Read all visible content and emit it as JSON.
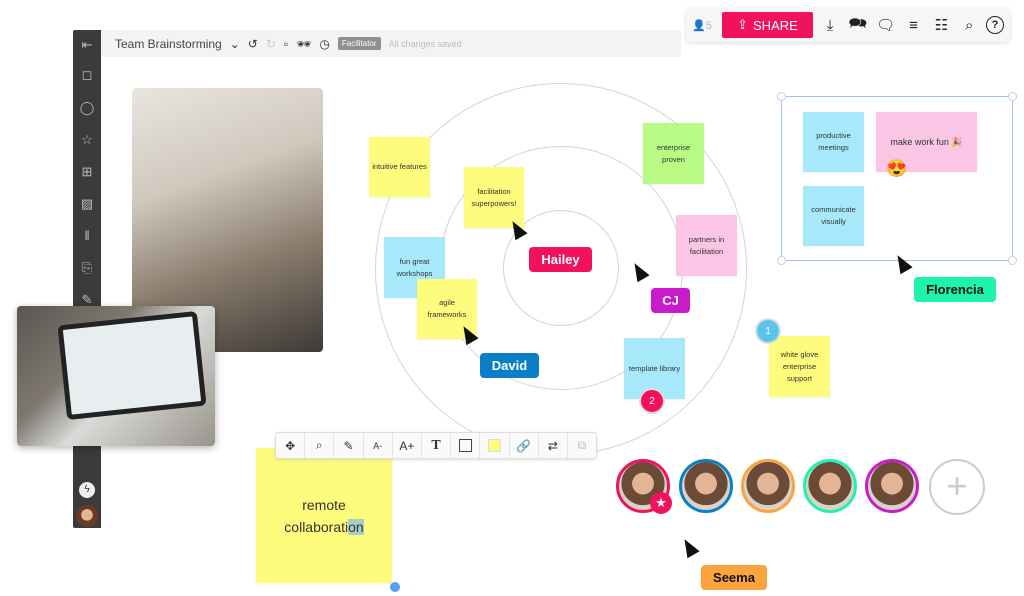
{
  "topbar": {
    "board_title": "Team Brainstorming",
    "facilitator_badge": "Facilitator",
    "save_status": "All changes saved"
  },
  "toolbar_right": {
    "participants_count": "5",
    "share_label": "SHARE",
    "icons": [
      "download-icon",
      "chat-icon",
      "comment-icon",
      "history-icon",
      "list-icon",
      "search-icon",
      "help-icon"
    ]
  },
  "sidebar": {
    "icons": [
      "exit-icon",
      "sticky-note-icon",
      "shapes-icon",
      "star-icon",
      "grid-icon",
      "image-icon",
      "library-icon",
      "import-icon",
      "pen-icon",
      "lightning-icon"
    ]
  },
  "notes": {
    "intuitive": "intuitive features",
    "facilitation": "facilitation superpowers!",
    "enterprise": "enterprise proven",
    "fun": "fun great workshops",
    "agile": "agile frameworks",
    "partners": "partners in facilitation",
    "template": "template library",
    "whiteglove": "white glove enterprise support",
    "productive": "productive meetings",
    "makefun": "make work fun 🎉",
    "communicate": "communicate visually",
    "remote_line1": "remote",
    "remote_line2a": "collaborati",
    "remote_line2b": "on"
  },
  "cursors": {
    "hailey": "Hailey",
    "cj": "CJ",
    "david": "David",
    "florencia": "Florencia",
    "seema": "Seema"
  },
  "colors": {
    "hailey": "#f0115f",
    "cj": "#c91bc9",
    "david": "#0a7fc8",
    "florencia": "#1ef3ae",
    "seema": "#fba33c",
    "accent": "#f0115f"
  },
  "badges": {
    "template_count": "2",
    "whiteglove_count": "1"
  },
  "format_toolbar": [
    "move-icon",
    "zoom-fit-icon",
    "pen-icon",
    "font-decrease-icon",
    "font-increase-icon",
    "text-icon",
    "border-icon",
    "color-swatch",
    "link-icon",
    "swap-icon",
    "duplicate-icon"
  ],
  "format_labels": {
    "font_dec": "A-",
    "font_inc": "A+",
    "text": "T"
  },
  "emoji": {
    "heart_eyes": "😍"
  }
}
